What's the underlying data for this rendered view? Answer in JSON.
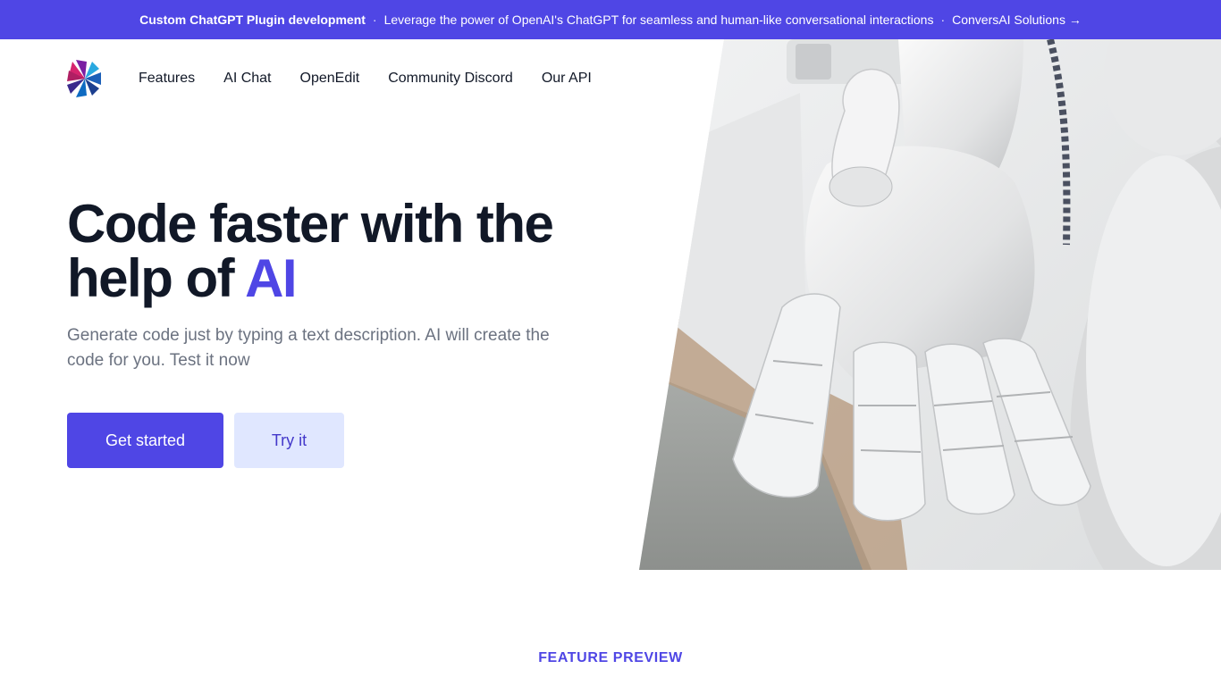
{
  "announcement": {
    "title": "Custom ChatGPT Plugin development",
    "separator": "·",
    "message": "Leverage the power of OpenAI's ChatGPT for seamless and human-like conversational interactions",
    "link_label": "ConversAI Solutions →"
  },
  "nav": {
    "logo_icon": "triangle-pinwheel-logo-icon",
    "items": [
      {
        "label": "Features"
      },
      {
        "label": "AI Chat"
      },
      {
        "label": "OpenEdit"
      },
      {
        "label": "Community Discord"
      },
      {
        "label": "Our API"
      }
    ]
  },
  "hero": {
    "title_line1": "Code faster with the",
    "title_line2_prefix": "help of ",
    "title_accent": "AI",
    "subtitle": "Generate code just by typing a text description. AI will create the code for you. Test it now",
    "primary_button": "Get started",
    "secondary_button": "Try it",
    "image_icon": "robot-hand-photo"
  },
  "feature_preview": {
    "eyebrow": "FEATURE PREVIEW"
  },
  "colors": {
    "accent": "#4f46e5",
    "accent_light": "#e0e7ff",
    "text_dark": "#111827",
    "text_muted": "#6b7280"
  }
}
